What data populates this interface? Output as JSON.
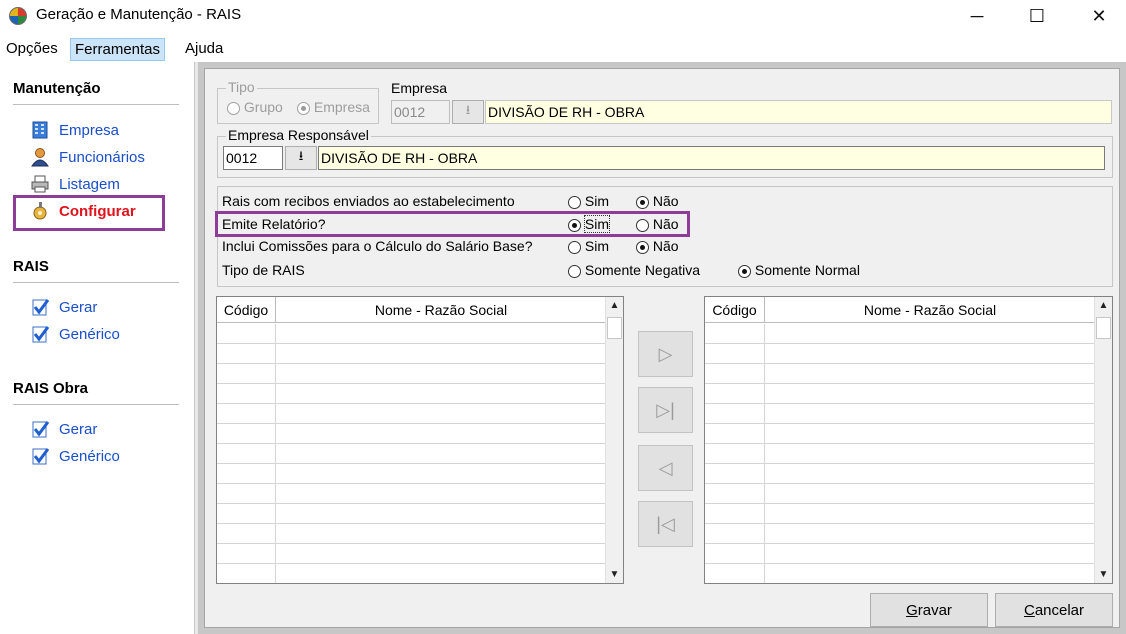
{
  "window": {
    "title": "Geração e Manutenção - RAIS",
    "controls": {
      "minimize": "─",
      "maximize": "☐",
      "close": "✕"
    }
  },
  "menu": [
    "Opções",
    "Ferramentas",
    "Ajuda"
  ],
  "sidebar": {
    "sections": [
      {
        "title": "Manutenção",
        "items": [
          {
            "label": "Empresa",
            "icon": "building-icon"
          },
          {
            "label": "Funcionários",
            "icon": "person-icon"
          },
          {
            "label": "Listagem",
            "icon": "printer-icon"
          },
          {
            "label": "Configurar",
            "icon": "config-icon"
          }
        ]
      },
      {
        "title": "RAIS",
        "items": [
          {
            "label": "Gerar",
            "icon": "checklist-icon"
          },
          {
            "label": "Genérico",
            "icon": "checklist-icon"
          }
        ]
      },
      {
        "title": "RAIS Obra",
        "items": [
          {
            "label": "Gerar",
            "icon": "checklist-icon"
          },
          {
            "label": "Genérico",
            "icon": "checklist-icon"
          }
        ]
      }
    ],
    "highlighted_item": "Configurar"
  },
  "form": {
    "tipo": {
      "label": "Tipo",
      "options": [
        "Grupo",
        "Empresa"
      ],
      "selected": "Empresa",
      "enabled": false
    },
    "empresa": {
      "label": "Empresa",
      "code": "0012",
      "name": "DIVISÃO DE RH - OBRA"
    },
    "empresa_responsavel": {
      "label": "Empresa Responsável",
      "code": "0012",
      "name": "DIVISÃO DE RH - OBRA"
    },
    "options": [
      {
        "label": "Rais com recibos enviados ao estabelecimento",
        "choices": [
          "Sim",
          "Não"
        ],
        "selected": "Não"
      },
      {
        "label": "Emite Relatório?",
        "choices": [
          "Sim",
          "Não"
        ],
        "selected": "Sim",
        "highlighted": true
      },
      {
        "label": "Inclui Comissões para o Cálculo do Salário Base?",
        "choices": [
          "Sim",
          "Não"
        ],
        "selected": "Não"
      },
      {
        "label": "Tipo de RAIS",
        "choices": [
          "Somente Negativa",
          "Somente Normal"
        ],
        "selected": "Somente Normal"
      }
    ]
  },
  "grids": {
    "left": {
      "columns": [
        "Código",
        "Nome - Razão Social"
      ],
      "rows": []
    },
    "right": {
      "columns": [
        "Código",
        "Nome - Razão Social"
      ],
      "rows": []
    }
  },
  "transfer_buttons": [
    {
      "name": "move-right",
      "glyph": "▷"
    },
    {
      "name": "move-all-right",
      "glyph": "▷|"
    },
    {
      "name": "move-left",
      "glyph": "◁"
    },
    {
      "name": "move-all-left",
      "glyph": "|◁"
    }
  ],
  "actions": {
    "save": {
      "accel": "G",
      "rest": "ravar"
    },
    "cancel": {
      "accel": "C",
      "rest": "ancelar"
    }
  },
  "colors": {
    "link": "#1a4fc7",
    "active_link": "#e0141c",
    "highlight_border": "#8d3d98",
    "field_yellow": "#ffffe1",
    "panel_background": "#f0f0f0"
  }
}
